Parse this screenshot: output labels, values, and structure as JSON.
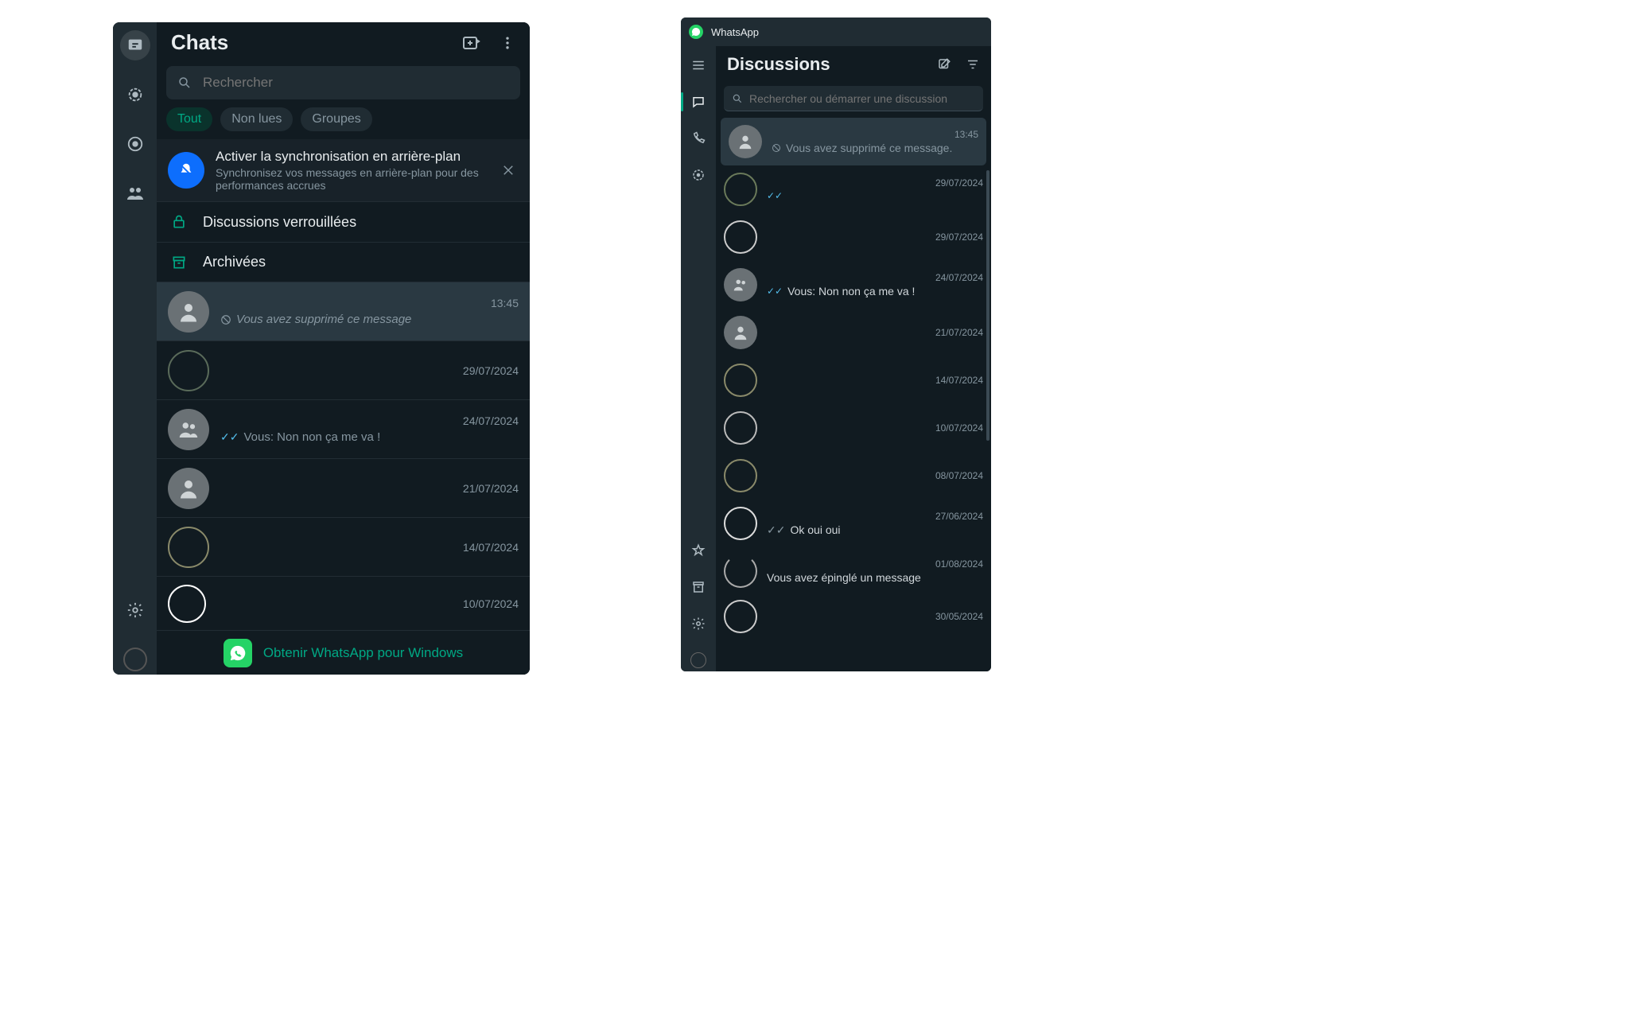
{
  "left": {
    "title": "Chats",
    "search_placeholder": "Rechercher",
    "filters": {
      "all": "Tout",
      "unread": "Non lues",
      "groups": "Groupes"
    },
    "banner": {
      "title": "Activer la synchronisation en arrière-plan",
      "sub": "Synchronisez vos messages en arrière-plan pour des performances accrues"
    },
    "locked_label": "Discussions verrouillées",
    "archived_label": "Archivées",
    "rows": [
      {
        "time": "13:45",
        "msg": "Vous avez supprimé ce message",
        "blocked": true
      },
      {
        "time": "29/07/2024",
        "msg": ""
      },
      {
        "time": "24/07/2024",
        "msg": "Vous: Non non ça me va !",
        "ticks": true
      },
      {
        "time": "21/07/2024",
        "msg": ""
      },
      {
        "time": "14/07/2024",
        "msg": ""
      },
      {
        "time": "10/07/2024",
        "msg": ""
      }
    ],
    "footer": "Obtenir WhatsApp pour Windows"
  },
  "right": {
    "app_title": "WhatsApp",
    "title": "Discussions",
    "search_placeholder": "Rechercher ou démarrer une discussion",
    "rows": [
      {
        "time": "13:45",
        "msg": "Vous avez supprimé ce message.",
        "blocked": true
      },
      {
        "time": "29/07/2024",
        "msg": "",
        "ticks": true
      },
      {
        "time": "29/07/2024",
        "msg": ""
      },
      {
        "time": "24/07/2024",
        "msg": "Vous: Non non ça me va !",
        "ticks": true
      },
      {
        "time": "21/07/2024",
        "msg": ""
      },
      {
        "time": "14/07/2024",
        "msg": ""
      },
      {
        "time": "10/07/2024",
        "msg": ""
      },
      {
        "time": "08/07/2024",
        "msg": ""
      },
      {
        "time": "27/06/2024",
        "msg": "Ok oui oui",
        "ticks_gray": true
      },
      {
        "time": "01/08/2024",
        "msg": "Vous avez épinglé un message"
      },
      {
        "time": "30/05/2024",
        "msg": ""
      }
    ]
  }
}
